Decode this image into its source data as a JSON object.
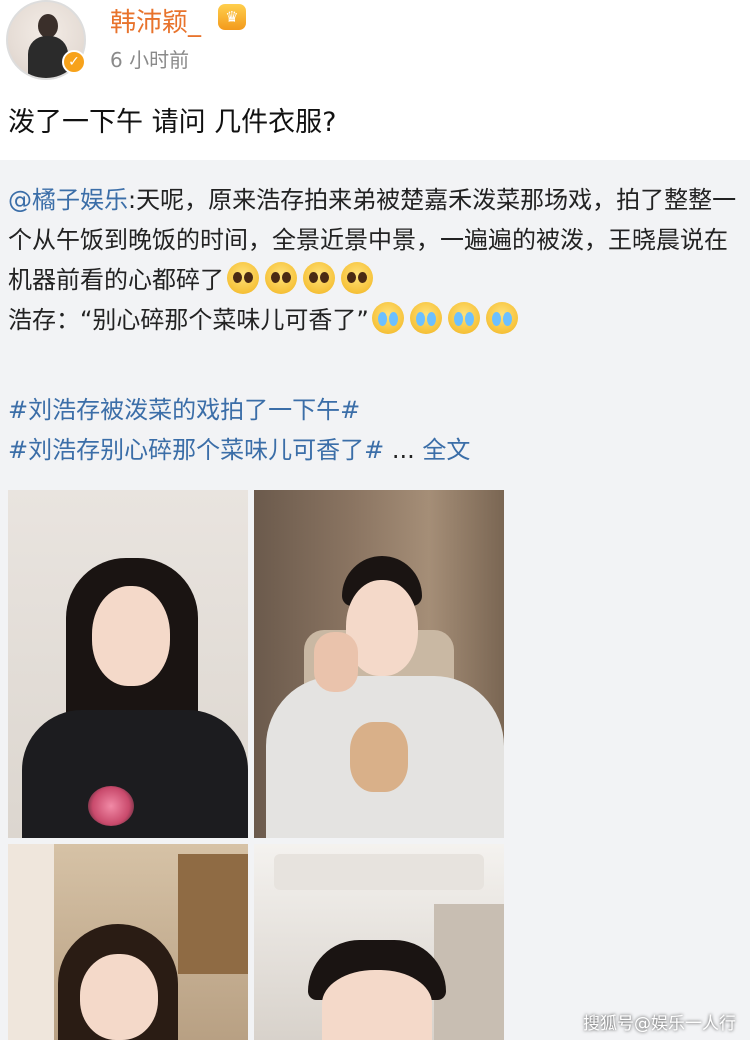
{
  "post": {
    "username": "韩沛颖_",
    "vip_badge": "♛",
    "verified_icon": "✓",
    "time": "6 小时前",
    "text": "泼了一下午 请问 几件衣服?"
  },
  "repost": {
    "mention": "@橘子娱乐",
    "line1": ":天呢，原来浩存拍来弟被楚嘉禾泼菜那场戏，拍了整整一个从午饭到晚饭的时间，全景近景中景，一遍遍的被泼，王晓晨说在机器前看的心都碎了",
    "line2": "浩存：“别心碎那个菜味儿可香了”",
    "hashtag1": "#刘浩存被泼菜的戏拍了一下午#",
    "hashtag2": "#刘浩存别心碎那个菜味儿可香了#",
    "ellipsis": " ... ",
    "full_text": "全文"
  },
  "watermark": "搜狐号@娱乐一人行",
  "icons": {
    "emoji_pleading": "pleading-face-emoji",
    "emoji_crying": "crying-face-emoji"
  }
}
